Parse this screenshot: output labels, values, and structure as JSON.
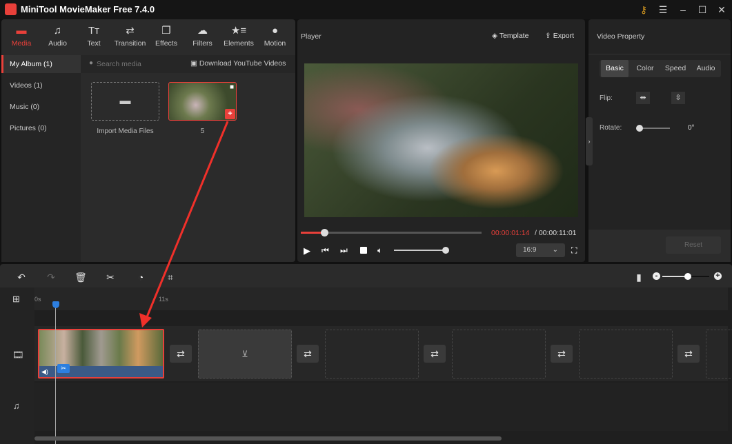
{
  "app": {
    "title": "MiniTool MovieMaker Free 7.4.0"
  },
  "window": {
    "key_icon": "key-icon",
    "menu_icon": "menu-icon",
    "minimize": "minimize-icon",
    "maximize": "maximize-icon",
    "close": "close-icon"
  },
  "toolbar": {
    "items": [
      {
        "label": "Media",
        "icon": "folder-icon"
      },
      {
        "label": "Audio",
        "icon": "music-icon"
      },
      {
        "label": "Text",
        "icon": "text-icon"
      },
      {
        "label": "Transition",
        "icon": "transition-icon"
      },
      {
        "label": "Effects",
        "icon": "effects-icon"
      },
      {
        "label": "Filters",
        "icon": "filters-icon"
      },
      {
        "label": "Elements",
        "icon": "elements-icon"
      },
      {
        "label": "Motion",
        "icon": "motion-icon"
      }
    ],
    "active": "Media"
  },
  "sidebar": {
    "items": [
      {
        "label": "My Album (1)"
      },
      {
        "label": "Videos (1)"
      },
      {
        "label": "Music (0)"
      },
      {
        "label": "Pictures (0)"
      }
    ]
  },
  "media": {
    "search_placeholder": "Search media",
    "download_label": "Download YouTube Videos",
    "import_label": "Import Media Files",
    "clip_name": "5"
  },
  "player": {
    "title": "Player",
    "template_label": "Template",
    "export_label": "Export",
    "current_time": "00:00:01:14",
    "total_time": "/ 00:00:11:01",
    "progress_fraction": 0.13,
    "volume_fraction": 1.0,
    "aspect_ratio": "16:9"
  },
  "property": {
    "title": "Video Property",
    "tabs": [
      "Basic",
      "Color",
      "Speed",
      "Audio"
    ],
    "active_tab": "Basic",
    "flip_label": "Flip:",
    "rotate_label": "Rotate:",
    "rotate_value": "0°",
    "reset_label": "Reset"
  },
  "timeline": {
    "ruler": [
      "0s",
      "11s"
    ],
    "zoom_fraction": 0.55
  },
  "colors": {
    "accent": "#e8403a",
    "playhead": "#2d7fe0"
  }
}
